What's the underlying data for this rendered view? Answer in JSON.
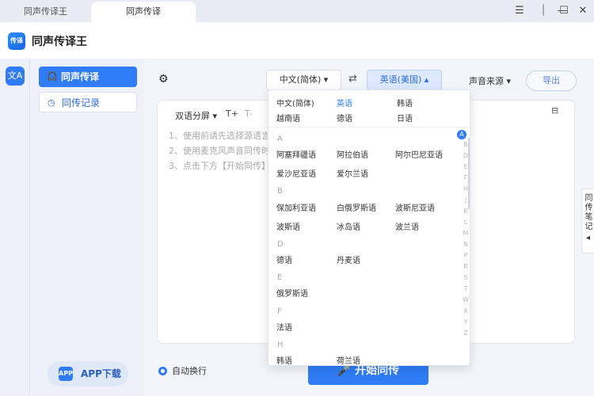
{
  "tabs": [
    "同声传译王",
    "同声传译"
  ],
  "window_controls": {
    "menu": "☰",
    "pin": "⏐",
    "minimize": "—",
    "maximize": "☐",
    "close": "✕"
  },
  "app": {
    "logo_text": "传译",
    "title": "同声传译王"
  },
  "rail": {
    "icon_text": "文A"
  },
  "sidebar": {
    "items": [
      {
        "label": "同声传译",
        "icon": "headphones-icon"
      },
      {
        "label": "同传记录",
        "icon": "clock-icon"
      }
    ],
    "app_download": "APP下载",
    "app_icon_text": "APP"
  },
  "toolbar": {
    "source_lang": "中文(简体) ▾",
    "target_lang": "英语(美国) ▴",
    "audio_source": "声音来源 ▾",
    "export": "导出"
  },
  "panel": {
    "bilingual": "双语分屏 ▾",
    "font_larger": "T+",
    "font_smaller": "T-",
    "tips": [
      "1、使用前请先选择源语言",
      "2、使用麦克风声音同传时",
      "3、点击下方【开始同传】"
    ]
  },
  "auto_wrap": "自动换行",
  "start_button": "开始同传",
  "notes_tab": "同传笔记",
  "dropdown": {
    "common": [
      {
        "label": "中文(简体)",
        "selected": false
      },
      {
        "label": "英语",
        "selected": true
      },
      {
        "label": "韩语",
        "selected": false
      },
      {
        "label": "越南语",
        "selected": false
      },
      {
        "label": "德语",
        "selected": false
      },
      {
        "label": "日语",
        "selected": false
      }
    ],
    "groups": [
      {
        "letter": "A",
        "items": [
          "阿塞拜疆语",
          "阿拉伯语",
          "阿尔巴尼亚语",
          "爱沙尼亚语",
          "爱尔兰语"
        ]
      },
      {
        "letter": "B",
        "items": [
          "保加利亚语",
          "白俄罗斯语",
          "波斯尼亚语",
          "波斯语",
          "冰岛语",
          "波兰语"
        ]
      },
      {
        "letter": "D",
        "items": [
          "德语",
          "丹麦语"
        ]
      },
      {
        "letter": "E",
        "items": [
          "俄罗斯语"
        ]
      },
      {
        "letter": "F",
        "items": [
          "法语"
        ]
      },
      {
        "letter": "H",
        "items": [
          "韩语",
          "荷兰语"
        ]
      }
    ],
    "index": [
      "A",
      "B",
      "D",
      "E",
      "F",
      "H",
      "J",
      "K",
      "L",
      "M",
      "N",
      "P",
      "R",
      "S",
      "T",
      "W",
      "X",
      "Y",
      "Z"
    ]
  }
}
